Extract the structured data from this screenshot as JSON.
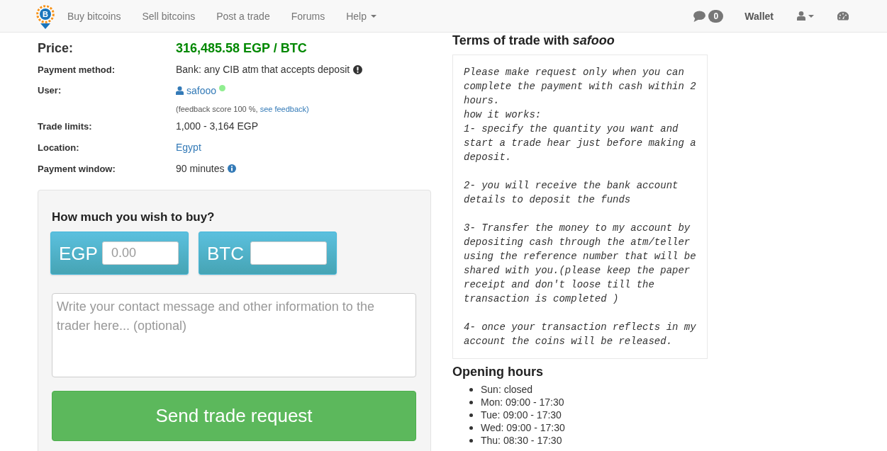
{
  "navbar": {
    "logo_mark": "B",
    "links": [
      {
        "label": "Buy bitcoins",
        "kind": "link"
      },
      {
        "label": "Sell bitcoins",
        "kind": "link"
      },
      {
        "label": "Post a trade",
        "kind": "link"
      },
      {
        "label": "Forums",
        "kind": "link"
      },
      {
        "label": "Help",
        "kind": "menu"
      }
    ],
    "message_count": "0",
    "wallet": "Wallet"
  },
  "offer": {
    "price": {
      "label": "Price:",
      "value": "316,485.58 EGP / BTC"
    },
    "details": [
      {
        "kind": "notice",
        "label": "Payment method:",
        "value": "Bank: any CIB atm that accepts deposit"
      },
      {
        "kind": "user",
        "label": "User:",
        "value": "safooo",
        "online": true,
        "feedback": "(feedback score 100 %, ",
        "feedback_link": "see feedback)"
      },
      {
        "kind": "plain",
        "label": "Trade limits:",
        "value": "1,000 - 3,164 EGP"
      },
      {
        "kind": "link",
        "label": "Location:",
        "value": "Egypt"
      },
      {
        "kind": "info",
        "label": "Payment window:",
        "value": "90 minutes"
      }
    ]
  },
  "trade_form": {
    "heading": "How much you wish to buy?",
    "amounts": [
      {
        "currency": "EGP",
        "placeholder": "0.00"
      },
      {
        "currency": "BTC"
      }
    ],
    "message": {
      "placeholder": "Write your contact message and other information to the trader here... (optional)"
    },
    "submit": "Send trade request"
  },
  "terms": {
    "title": "Terms of trade with *safooo*",
    "text": "Please make request only when you can complete the payment with cash within 2 hours.\nhow it works:\n1- specify the quantity you want and start a trade hear just before making a deposit.\n\n2- you will receive the bank account details to deposit the funds\n\n3- Transfer the money to my account by depositing cash through the atm/teller using the reference number that will be shared with you.(please keep the paper receipt and don't loose till the transaction is completed )\n\n4- once your transaction reflects in my account the coins will be released."
  },
  "opening_hours": {
    "title": "Opening hours",
    "days": [
      "Sun: closed",
      "Mon: 09:00 - 17:30",
      "Tue: 09:00 - 17:30",
      "Wed: 09:00 - 17:30",
      "Thu: 08:30 - 17:30"
    ]
  }
}
